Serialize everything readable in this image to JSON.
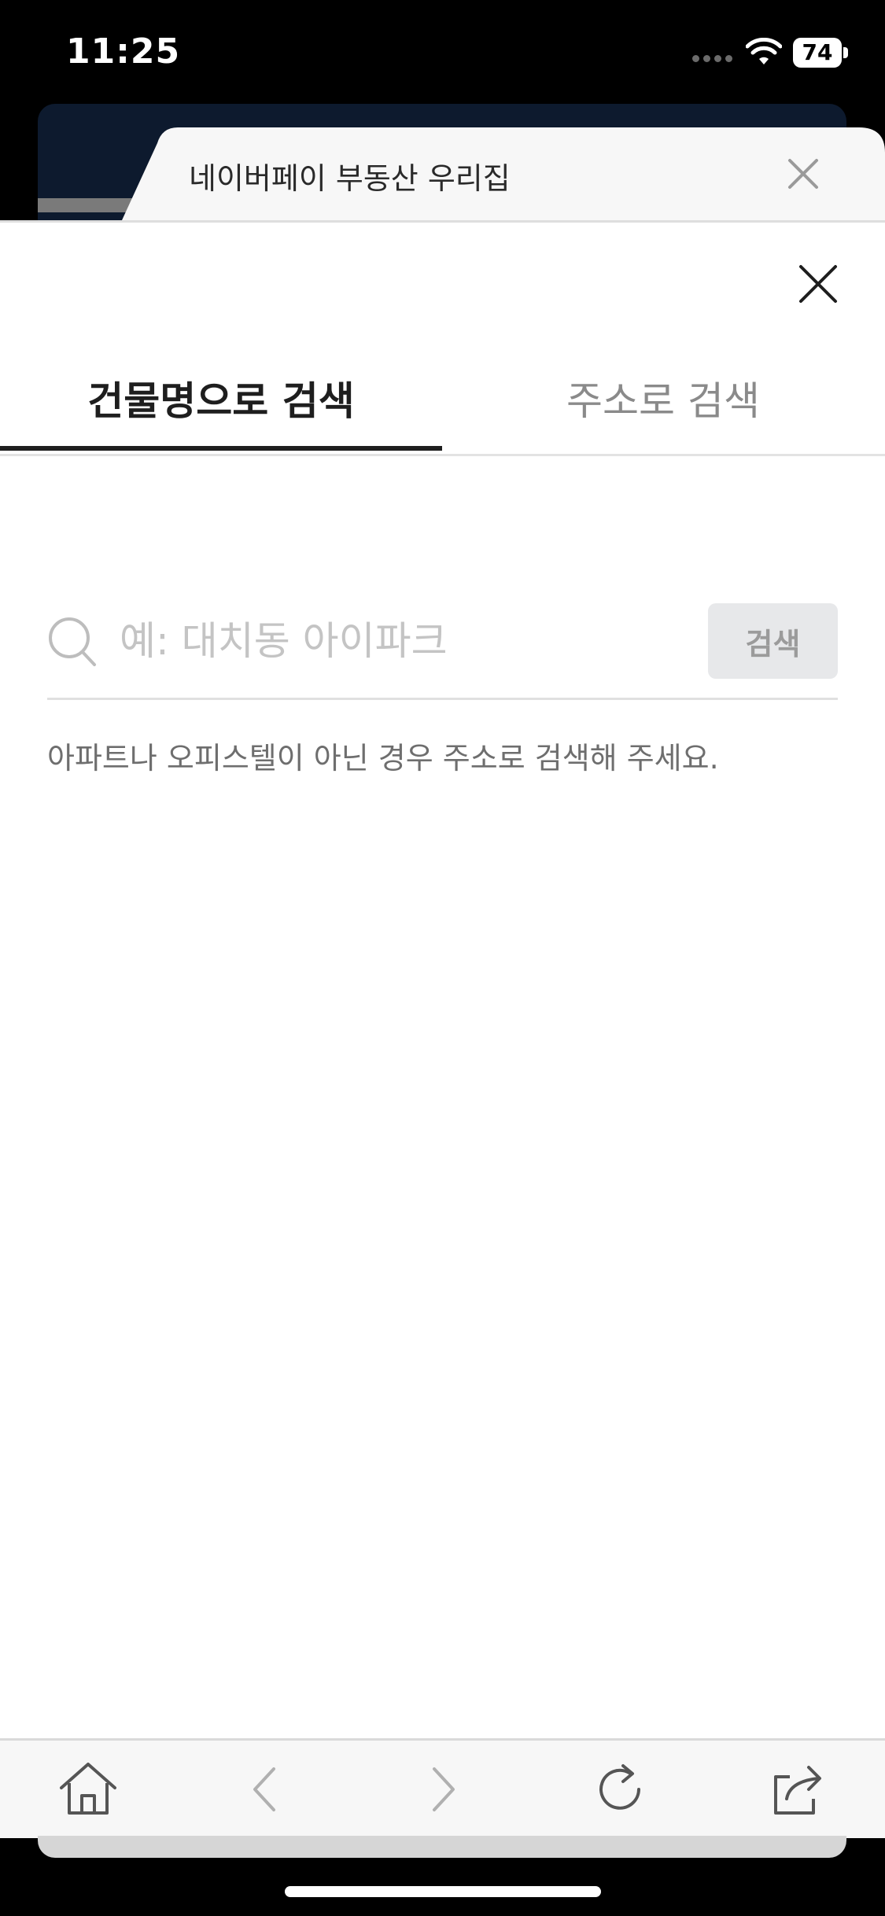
{
  "status_bar": {
    "time": "11:25",
    "battery": "74"
  },
  "browser_tab": {
    "title": "네이버페이 부동산 우리집"
  },
  "tabs": [
    {
      "label": "건물명으로 검색"
    },
    {
      "label": "주소로 검색"
    }
  ],
  "search": {
    "placeholder": "예: 대치동 아이파크",
    "value": "",
    "button_label": "검색"
  },
  "hint": "아파트나 오피스텔이 아닌 경우 주소로 검색해 주세요.",
  "colors": {
    "accent": "#1e1e1e",
    "inactive_tab": "#8a8a8a",
    "placeholder": "#c4c4c4"
  },
  "toolbar": {
    "icons": [
      "home-icon",
      "back-icon",
      "forward-icon",
      "reload-icon",
      "share-icon"
    ]
  }
}
